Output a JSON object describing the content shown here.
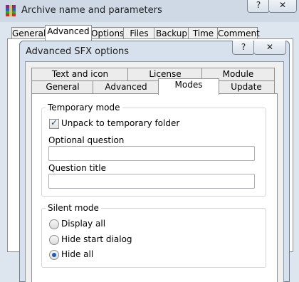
{
  "outer_dialog": {
    "title": "Archive name and parameters",
    "help_btn": "?",
    "close_btn": "✕",
    "tabs": [
      "General",
      "Advanced",
      "Options",
      "Files",
      "Backup",
      "Time",
      "Comment"
    ],
    "selected_tab": "Advanced"
  },
  "inner_dialog": {
    "title": "Advanced SFX options",
    "help_btn": "?",
    "close_btn": "✕",
    "tabs_row1": [
      "Text and icon",
      "License",
      "Module"
    ],
    "tabs_row2": [
      "General",
      "Advanced",
      "Modes",
      "Update"
    ],
    "selected_tab": "Modes",
    "temporary_mode": {
      "legend": "Temporary mode",
      "unpack_label": "Unpack to temporary folder",
      "unpack_checked": true,
      "optional_question_label": "Optional question",
      "optional_question_value": "",
      "question_title_label": "Question title",
      "question_title_value": ""
    },
    "silent_mode": {
      "legend": "Silent mode",
      "options": [
        "Display all",
        "Hide start dialog",
        "Hide all"
      ],
      "selected": "Hide all"
    }
  }
}
